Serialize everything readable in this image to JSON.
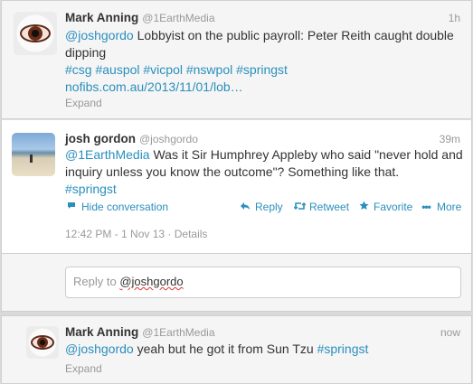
{
  "tweets": [
    {
      "name": "Mark Anning",
      "handle": "@1EarthMedia",
      "time": "1h",
      "text_parts": [
        "@joshgordo",
        "Lobbyist on the public payroll: Peter Reith caught double dipping",
        "#csg #auspol #vicpol #nswpol #springst",
        "nofibs.com.au/2013/11/01/lob…"
      ],
      "expand": "Expand"
    },
    {
      "name": "josh gordon",
      "handle": "@joshgordo",
      "time": "39m",
      "text_parts": [
        "@1EarthMedia",
        "Was it Sir Humphrey Appleby who said \"never hold and inquiry unless you know the outcome\"? Something like that.",
        "#springst"
      ],
      "hide_conversation": "Hide conversation",
      "actions": {
        "reply": "Reply",
        "retweet": "Retweet",
        "favorite": "Favorite",
        "more": "More"
      },
      "timestamp": "12:42 PM - 1 Nov 13",
      "details": "Details"
    },
    {
      "name": "Mark Anning",
      "handle": "@1EarthMedia",
      "time": "now",
      "text_parts": [
        "@joshgordo",
        "yeah but he got it from Sun Tzu",
        "#springst"
      ],
      "expand": "Expand"
    }
  ],
  "reply_box": {
    "prefix": "Reply to",
    "mention": "@joshgordo"
  },
  "colors": {
    "link": "#2a8fbd",
    "muted": "#999999",
    "text": "#333333"
  },
  "icons": {
    "hide_conversation": "speech-bubble-icon",
    "reply": "reply-arrow-icon",
    "retweet": "retweet-icon",
    "favorite": "star-icon",
    "more": "ellipsis-icon"
  }
}
